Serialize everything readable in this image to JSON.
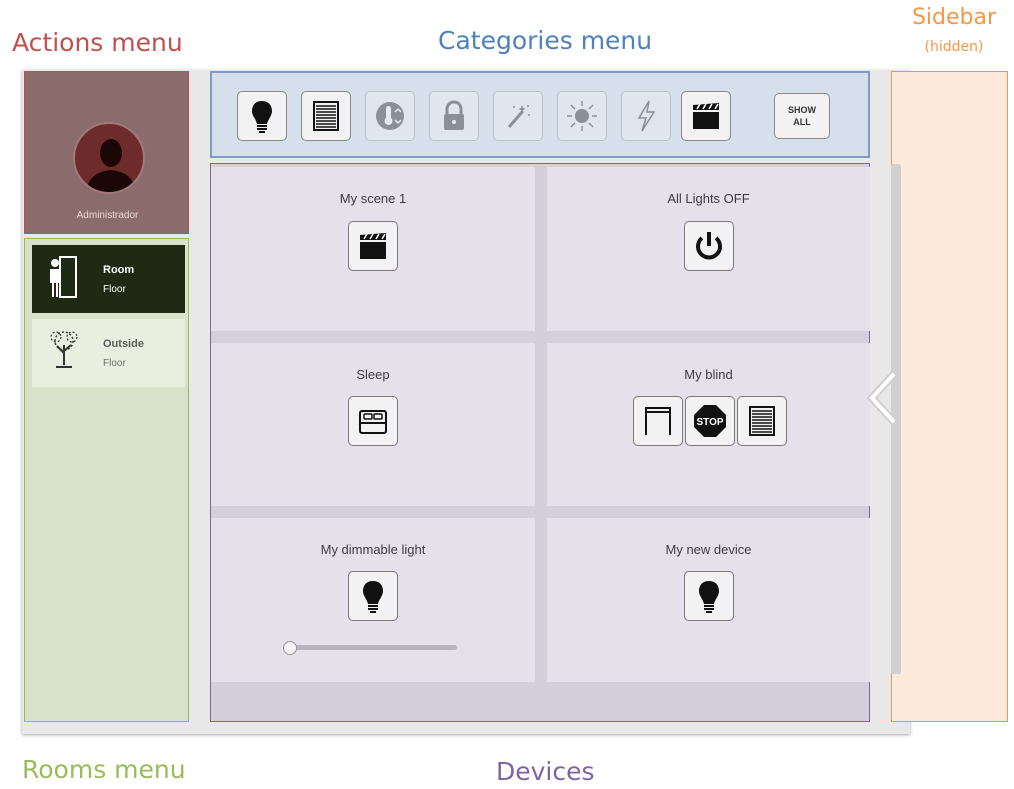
{
  "annotations": {
    "actions_menu": "Actions menu",
    "categories_menu": "Categories menu",
    "sidebar": "Sidebar",
    "sidebar_note": "(hidden)",
    "rooms_menu": "Rooms menu",
    "devices": "Devices"
  },
  "user": {
    "name": "Administrador",
    "avatar_icon": "user-silhouette-icon"
  },
  "rooms": [
    {
      "name": "Room",
      "floor": "Floor",
      "icon": "door-person-icon",
      "active": true
    },
    {
      "name": "Outside",
      "floor": "Floor",
      "icon": "tree-icon",
      "active": false
    }
  ],
  "categories": {
    "items": [
      {
        "icon": "lightbulb-icon",
        "enabled": true
      },
      {
        "icon": "blind-icon",
        "enabled": true
      },
      {
        "icon": "thermostat-icon",
        "enabled": false
      },
      {
        "icon": "lock-icon",
        "enabled": false
      },
      {
        "icon": "magic-wand-icon",
        "enabled": false
      },
      {
        "icon": "sun-icon",
        "enabled": false
      },
      {
        "icon": "lightning-icon",
        "enabled": false
      },
      {
        "icon": "clapperboard-icon",
        "enabled": true
      }
    ],
    "show_all_line1": "SHOW",
    "show_all_line2": "ALL"
  },
  "devices": [
    {
      "title": "My scene 1",
      "controls": [
        "clapperboard-icon"
      ]
    },
    {
      "title": "All Lights OFF",
      "controls": [
        "power-icon"
      ]
    },
    {
      "title": "Sleep",
      "controls": [
        "bed-icon"
      ]
    },
    {
      "title": "My blind",
      "controls": [
        "blind-open-icon",
        "stop-icon",
        "blind-closed-icon"
      ]
    },
    {
      "title": "My dimmable light",
      "controls": [
        "lightbulb-icon"
      ],
      "dimmer_level": 0
    },
    {
      "title": "My new device",
      "controls": [
        "lightbulb-icon"
      ]
    }
  ],
  "colors": {
    "actions": "#c0504d",
    "categories": "#4f81bd",
    "sidebar": "#f79646",
    "rooms": "#9bbb59",
    "devices": "#8064a2"
  }
}
